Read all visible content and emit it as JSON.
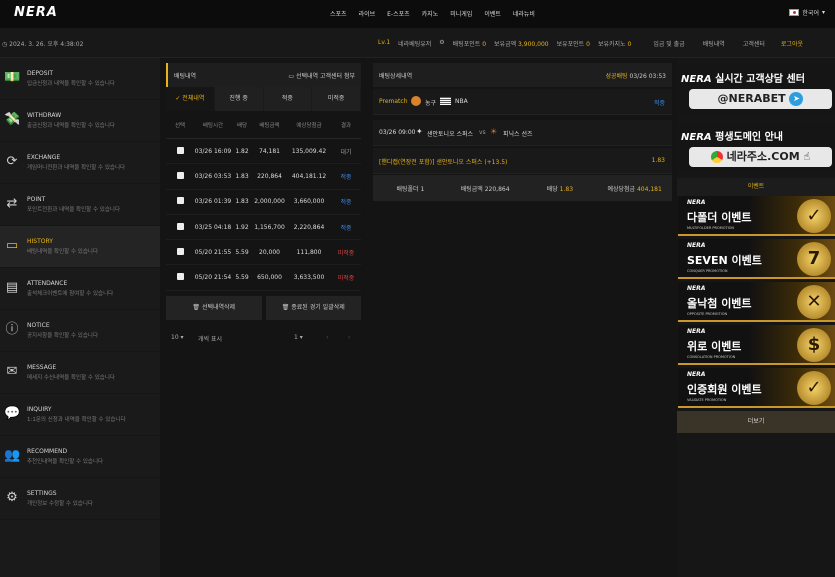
{
  "brand": {
    "logo": "NERA"
  },
  "topnav": {
    "items": [
      "스포츠",
      "라이브",
      "E-스포츠",
      "카지노",
      "미니게임",
      "이벤트",
      "네라뉴비"
    ],
    "language": "한국어"
  },
  "status": {
    "datetime": "2024. 3. 26. 오후 4:38:02"
  },
  "user": {
    "level": "Lv.1",
    "name": "네라베팅유저",
    "points_label": "배팅포인트",
    "points": "0",
    "money_label": "보유금액",
    "money": "3,900,000",
    "bonus_label": "보유포인트",
    "bonus": "0",
    "casino_label": "보유카지노",
    "casino": "0",
    "links": [
      "입금 및 출금",
      "배팅내역",
      "고객센터",
      "로그아웃"
    ]
  },
  "sidebar": {
    "items": [
      {
        "title": "DEPOSIT",
        "desc": "입금신청과 내역을 확인할 수 있습니다",
        "icon": "deposit-icon",
        "glyph": "💵"
      },
      {
        "title": "WITHDRAW",
        "desc": "출금신청과 내역을 확인할 수 있습니다",
        "icon": "withdraw-icon",
        "glyph": "💸"
      },
      {
        "title": "EXCHANGE",
        "desc": "게임머니전환과 내역을 확인할 수 있습니다",
        "icon": "exchange-icon",
        "glyph": "⟳"
      },
      {
        "title": "POINT",
        "desc": "포인트전환과 내역을 확인할 수 있습니다",
        "icon": "point-icon",
        "glyph": "⇄"
      },
      {
        "title": "HISTORY",
        "desc": "배팅내역을 확인할 수 있습니다",
        "icon": "folder-icon",
        "glyph": "▭"
      },
      {
        "title": "ATTENDANCE",
        "desc": "출석체크이벤트에 참여할 수 있습니다",
        "icon": "clipboard-icon",
        "glyph": "▤"
      },
      {
        "title": "NOTICE",
        "desc": "공지사항을 확인할 수 있습니다",
        "icon": "info-icon",
        "glyph": "ⓘ"
      },
      {
        "title": "MESSAGE",
        "desc": "메세지 수신내역을 확인할 수 있습니다",
        "icon": "mail-icon",
        "glyph": "✉"
      },
      {
        "title": "INQUIRY",
        "desc": "1:1문의 신청과 내역을 확인할 수 있습니다",
        "icon": "chat-icon",
        "glyph": "💬"
      },
      {
        "title": "RECOMMEND",
        "desc": "추천인내역을 확인할 수 있습니다",
        "icon": "users-icon",
        "glyph": "👥"
      },
      {
        "title": "SETTINGS",
        "desc": "개인정보 수정할 수 있습니다",
        "icon": "user-gear-icon",
        "glyph": "⚙"
      }
    ]
  },
  "history": {
    "title": "배팅내역",
    "attach_label": "선택내역 고객센터 첨부",
    "tabs": [
      "전체내역",
      "진행 중",
      "적중",
      "미적중"
    ],
    "columns": [
      "선택",
      "배팅시간",
      "배당",
      "배팅금액",
      "예상당첨금",
      "결과"
    ],
    "rows": [
      {
        "time": "03/26 16:09",
        "odds": "1.82",
        "amount": "74,181",
        "win": "135,009.42",
        "result": "대기",
        "status": "pending"
      },
      {
        "time": "03/26 03:53",
        "odds": "1.83",
        "amount": "220,864",
        "win": "404,181.12",
        "result": "적중",
        "status": "win"
      },
      {
        "time": "03/26 01:39",
        "odds": "1.83",
        "amount": "2,000,000",
        "win": "3,660,000",
        "result": "적중",
        "status": "win"
      },
      {
        "time": "03/25 04:18",
        "odds": "1.92",
        "amount": "1,156,700",
        "win": "2,220,864",
        "result": "적중",
        "status": "win"
      },
      {
        "time": "05/20 21:55",
        "odds": "5.59",
        "amount": "20,000",
        "win": "111,800",
        "result": "미적중",
        "status": "loss"
      },
      {
        "time": "05/20 21:54",
        "odds": "5.59",
        "amount": "650,000",
        "win": "3,633,500",
        "result": "미적중",
        "status": "loss"
      }
    ],
    "delete_selected": "선택내역삭제",
    "delete_finished": "종료된 경기 일괄삭제",
    "page_size": "10",
    "page_size_suffix": "개씩 표시",
    "page": "1",
    "prev": "‹",
    "next": "›"
  },
  "detail": {
    "title": "배팅상세내역",
    "status": "성공배팅",
    "time": "03/26 03:53",
    "match_type": "Prematch",
    "sport": "농구",
    "league": "NBA",
    "result": "적중",
    "match_time": "03/26 09:00",
    "home": "샌안토니오 스퍼스",
    "vs": "vs",
    "away": "피닉스 선즈",
    "market": "[핸디캡(연장전 포함)] 샌안토니오 스퍼스 (+13.5)",
    "pick_odds": "1.83",
    "summary": {
      "folder_label": "배팅폴더",
      "folder": "1",
      "amount_label": "배팅금액",
      "amount": "220,864",
      "odds_label": "배당",
      "odds": "1.83",
      "win_label": "예상당첨금",
      "win": "404,181"
    }
  },
  "banners": [
    {
      "brand": "NERA",
      "title": "실시간 고객상담 센터",
      "pill": "@NERABET",
      "pill_icon": "telegram-icon",
      "pill_glyph": "➤",
      "pill_bg": "#e8e8e8",
      "pill_color": "#222"
    },
    {
      "brand": "NERA",
      "title": "평생도메인 안내",
      "pill": "네라주소.COM",
      "pill_icon": "chrome-icon",
      "pill_glyph": "◉",
      "pill_bg": "#e8e8e8",
      "pill_color": "#222"
    }
  ],
  "events": {
    "title": "이벤트",
    "items": [
      {
        "name": "다폴더 이벤트",
        "sub": "MULTIFOLDER PROMOTION",
        "glyph": "✓",
        "icon": "check-medal-icon"
      },
      {
        "name": "SEVEN 이벤트",
        "sub": "CONQUER PROMOTION",
        "glyph": "7",
        "icon": "seven-icon"
      },
      {
        "name": "올낙첨 이벤트",
        "sub": "OPPOSITE PROMOTION",
        "glyph": "✕",
        "icon": "x-medal-icon"
      },
      {
        "name": "위로 이벤트",
        "sub": "CONSOLATION PROMOTION",
        "glyph": "$",
        "icon": "coin-icon"
      },
      {
        "name": "인증회원 이벤트",
        "sub": "VALIDATE PROMOTION",
        "glyph": "✓",
        "icon": "shield-check-icon"
      }
    ],
    "more": "더보기"
  }
}
